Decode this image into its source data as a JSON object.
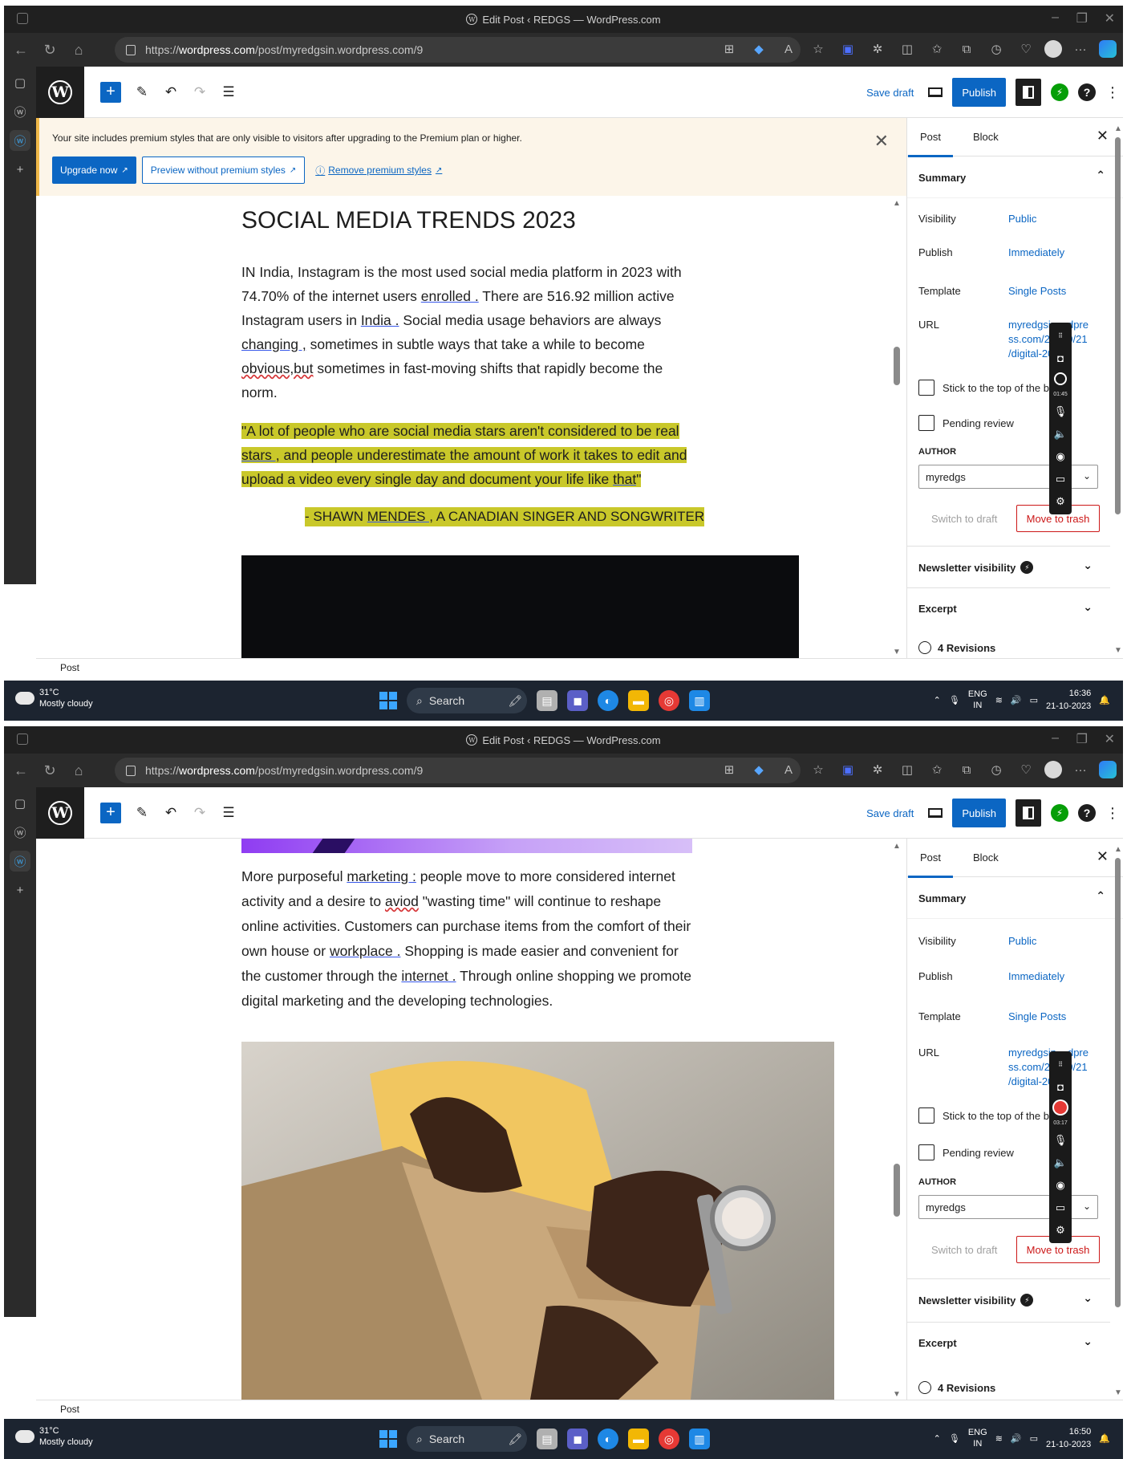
{
  "shots": [
    {
      "browser": {
        "window_title": "Edit Post ‹ REDGS — WordPress.com",
        "url_prefix": "https://",
        "url_domain": "wordpress.com",
        "url_path": "/post/myredgsin.wordpress.com/9"
      },
      "header": {
        "save_draft": "Save draft",
        "publish": "Publish"
      },
      "notice": {
        "text": "Your site includes premium styles that are only visible to visitors after upgrading to the Premium plan or higher.",
        "upgrade": "Upgrade now",
        "preview": "Preview without premium styles",
        "remove": "Remove premium styles"
      },
      "post": {
        "title": "SOCIAL MEDIA TRENDS 2023",
        "para1": {
          "a": "IN India, Instagram is the most used social media platform in 2023 with 74.70% of the internet users ",
          "link1": "enrolled .",
          "b": " There are 516.92 million active Instagram users in ",
          "link2": "India .",
          "c": " Social media usage behaviors are always ",
          "link3": "changing  ,",
          "d": " sometimes in subtle ways that take a while to become ",
          "typo": "obvious,but",
          "e": " sometimes in fast-moving shifts that rapidly become the norm."
        },
        "quote": {
          "line1": "\"A lot of people who are social media stars aren't considered to be real",
          "line2a": "stars ,",
          "line2b": " and people underestimate the amount of work it takes to edit and",
          "line3a": "upload a video every single day and document your life like ",
          "line3b": "that",
          "line3c": "\"",
          "attribution_a": "- SHAWN ",
          "attribution_b": "MENDES ,",
          "attribution_c": " A CANADIAN SINGER AND SONGWRITER"
        }
      },
      "sidebar": {
        "tab_post": "Post",
        "tab_block": "Block",
        "summary": "Summary",
        "visibility_label": "Visibility",
        "visibility_value": "Public",
        "publish_label": "Publish",
        "publish_value": "Immediately",
        "template_label": "Template",
        "template_value": "Single Posts",
        "url_label": "URL",
        "url_line1": "myredgsin",
        "url_line1b": "dpre",
        "url_line2": "ss.com/20",
        "url_line2b": "0/21",
        "url_line3": "/digital-20",
        "sticky": "Stick to the top of the blog",
        "pending": "Pending review",
        "author_label": "AUTHOR",
        "author_value": "myredgs",
        "switch_draft": "Switch to draft",
        "trash": "Move to trash",
        "newsletter": "Newsletter visibility",
        "excerpt": "Excerpt",
        "revisions": "4 Revisions"
      },
      "recorder_timer": "01:45",
      "footer": "Post",
      "taskbar": {
        "temp": "31°C",
        "weather": "Mostly cloudy",
        "search": "Search",
        "lang1": "ENG",
        "lang2": "IN",
        "time": "16:36",
        "date": "21-10-2023"
      }
    },
    {
      "browser": {
        "window_title": "Edit Post ‹ REDGS — WordPress.com",
        "url_prefix": "https://",
        "url_domain": "wordpress.com",
        "url_path": "/post/myredgsin.wordpress.com/9"
      },
      "header": {
        "save_draft": "Save draft",
        "publish": "Publish"
      },
      "post": {
        "para2": {
          "a": "More purposeful ",
          "link1": "marketing :",
          "b": " people move to more considered internet activity and a desire to ",
          "typo": "aviod",
          "c": " \"wasting time\" will continue to reshape online activities. Customers can purchase items from the comfort of their own house or ",
          "link2": "workplace .",
          "d": " Shopping is made easier and convenient for the customer through the ",
          "link3": "internet .",
          "e": " Through online shopping we promote digital marketing and the developing technologies."
        }
      },
      "sidebar": {
        "tab_post": "Post",
        "tab_block": "Block",
        "summary": "Summary",
        "visibility_label": "Visibility",
        "visibility_value": "Public",
        "publish_label": "Publish",
        "publish_value": "Immediately",
        "template_label": "Template",
        "template_value": "Single Posts",
        "url_label": "URL",
        "url_line1": "myredgsin",
        "url_line1b": "dpre",
        "url_line2": "ss.com/20",
        "url_line2b": "0/21",
        "url_line3": "/digital-20",
        "sticky": "Stick to the top of the blog",
        "pending": "Pending review",
        "author_label": "AUTHOR",
        "author_value": "myredgs",
        "switch_draft": "Switch to draft",
        "trash": "Move to trash",
        "newsletter": "Newsletter visibility",
        "excerpt": "Excerpt",
        "revisions": "4 Revisions"
      },
      "recorder_timer": "03:17",
      "footer": "Post",
      "taskbar": {
        "temp": "31°C",
        "weather": "Mostly cloudy",
        "search": "Search",
        "lang1": "ENG",
        "lang2": "IN",
        "time": "16:50",
        "date": "21-10-2023"
      }
    }
  ],
  "colors": {
    "wp_blue": "#0b66c3",
    "highlight": "#c9c82a",
    "trash_red": "#cc1818",
    "notice_bg": "#fcf5e9",
    "taskbar_bg": "#1c2430"
  },
  "icons": [
    "wordpress-logo-icon",
    "plus-icon",
    "pencil-icon",
    "undo-icon",
    "redo-icon",
    "list-view-icon",
    "preview-icon",
    "settings-icon",
    "jetpack-icon",
    "help-icon",
    "close-icon",
    "chevron-up-icon",
    "chevron-down-icon",
    "external-link-icon",
    "clock-icon",
    "search-icon",
    "windows-icon",
    "wifi-icon",
    "cloud-icon"
  ]
}
